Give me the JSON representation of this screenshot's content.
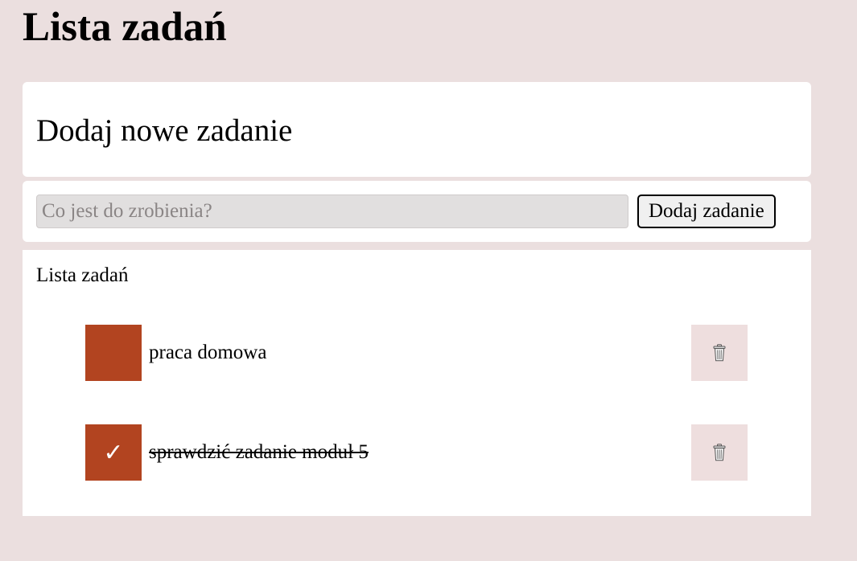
{
  "app": {
    "title": "Lista zadań"
  },
  "add_section": {
    "heading": "Dodaj nowe zadanie",
    "input_value": "",
    "input_placeholder": "Co jest do zrobienia?",
    "button_label": "Dodaj zadanie"
  },
  "list_section": {
    "heading": "Lista zadań",
    "tasks": [
      {
        "text": "praca domowa",
        "done": false,
        "check_glyph": ""
      },
      {
        "text": "sprawdzić zadanie moduł 5",
        "done": true,
        "check_glyph": "✓"
      }
    ],
    "delete_icon": "trash-icon"
  },
  "colors": {
    "background": "#ebdfdf",
    "accent": "#b24420",
    "delete_bg": "#eedede",
    "input_bg": "#e1dfdf"
  }
}
